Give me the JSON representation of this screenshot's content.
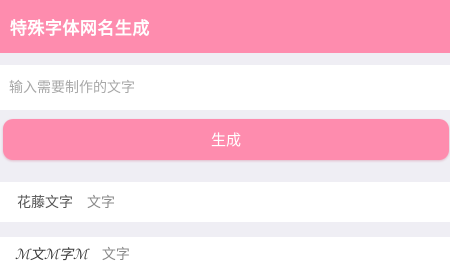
{
  "header": {
    "title": "特殊字体网名生成"
  },
  "input": {
    "placeholder": "输入需要制作的文字",
    "value": ""
  },
  "generate_button": {
    "label": "生成"
  },
  "results": [
    {
      "style_name": "花藤文字",
      "preview": "文字"
    },
    {
      "style_name": "ℳ文ℳ字ℳ",
      "preview": "文字"
    }
  ],
  "colors": {
    "accent": "#fe8cae",
    "background": "#efeef4",
    "card": "#ffffff"
  }
}
